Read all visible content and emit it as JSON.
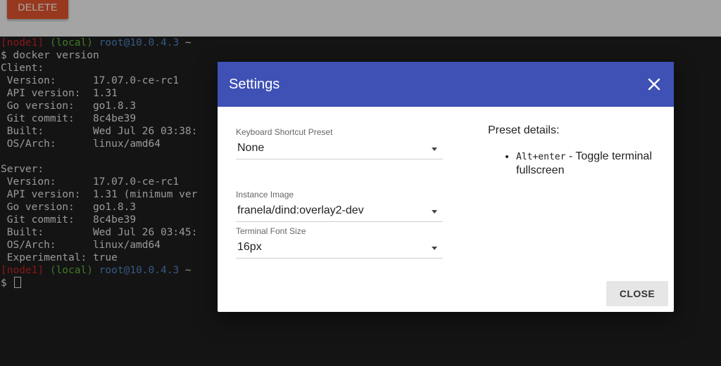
{
  "topbar": {
    "delete_label": "DELETE"
  },
  "terminal": {
    "prompt": {
      "node": "[node1]",
      "env": "(local)",
      "host": "root@10.0.4.3",
      "tilde": "~"
    },
    "lines": [
      "$ docker version",
      "Client:",
      " Version:      17.07.0-ce-rc1",
      " API version:  1.31",
      " Go version:   go1.8.3",
      " Git commit:   8c4be39",
      " Built:        Wed Jul 26 03:38:",
      " OS/Arch:      linux/amd64",
      "",
      "Server:",
      " Version:      17.07.0-ce-rc1",
      " API version:  1.31 (minimum ver",
      " Go version:   go1.8.3",
      " Git commit:   8c4be39",
      " Built:        Wed Jul 26 03:45:",
      " OS/Arch:      linux/amd64",
      " Experimental: true"
    ],
    "final_prompt_symbol": "$"
  },
  "dialog": {
    "title": "Settings",
    "close_icon": "close-icon",
    "fields": [
      {
        "label": "Keyboard Shortcut Preset",
        "value": "None"
      },
      {
        "label": "Instance Image",
        "value": "franela/dind:overlay2-dev"
      },
      {
        "label": "Terminal Font Size",
        "value": "16px"
      }
    ],
    "details": {
      "title": "Preset details:",
      "items": [
        {
          "key": "Alt+enter",
          "text": " - Toggle terminal fullscreen"
        }
      ]
    },
    "close_label": "CLOSE",
    "accent": "#3f51b5"
  }
}
